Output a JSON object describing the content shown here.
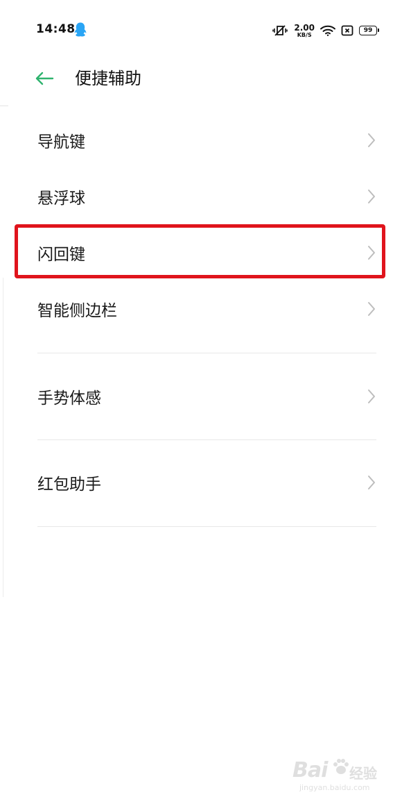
{
  "status_bar": {
    "time": "14:48",
    "net_speed": "2.00",
    "net_speed_unit": "KB/S",
    "battery": "99"
  },
  "header": {
    "title": "便捷辅助"
  },
  "menu": {
    "items": [
      {
        "label": "导航键"
      },
      {
        "label": "悬浮球"
      },
      {
        "label": "闪回键"
      },
      {
        "label": "智能侧边栏"
      },
      {
        "label": "手势体感"
      },
      {
        "label": "红包助手"
      }
    ]
  },
  "colors": {
    "accent": "#2fb36e",
    "highlight": "#e0141c",
    "qq_icon": "#2aa5f5"
  },
  "watermark": {
    "brand": "Bai",
    "cn": "经验",
    "url": "jingyan.baidu.com"
  }
}
